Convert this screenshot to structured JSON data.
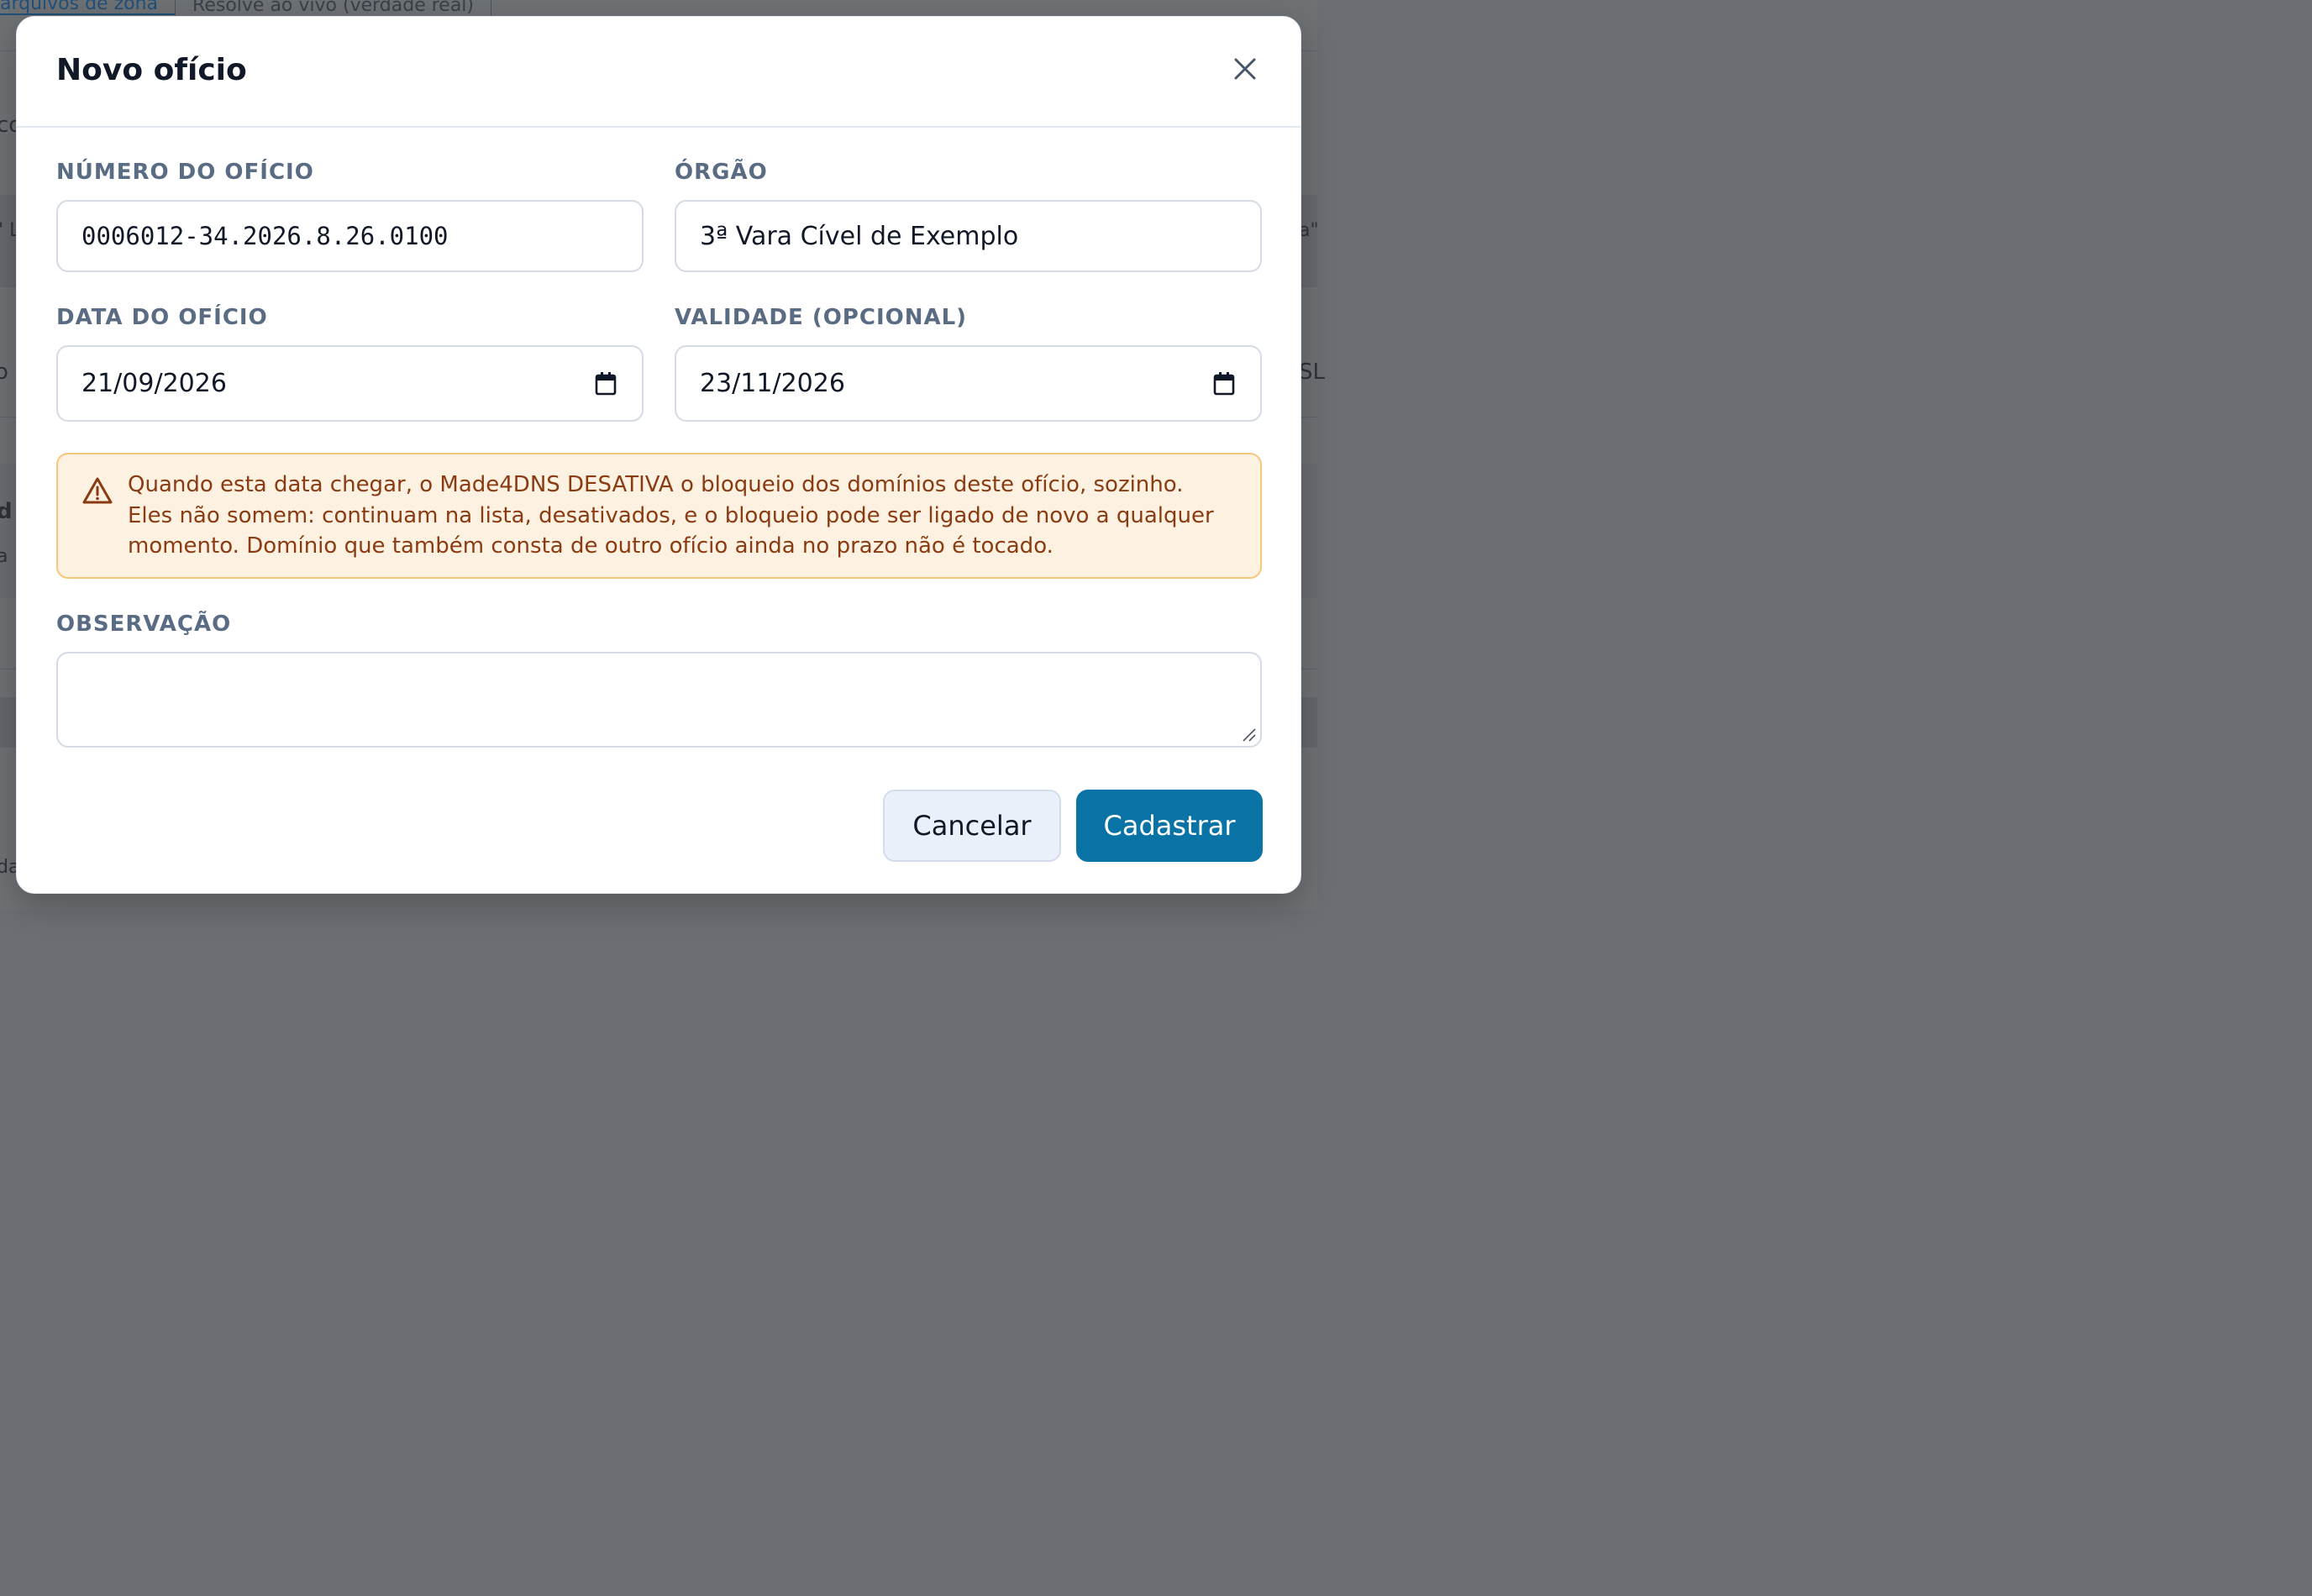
{
  "background": {
    "tabs": [
      {
        "label": "arquivos de zona",
        "active": true
      },
      {
        "label": "Resolve ao vivo (verdade real)",
        "active": false
      }
    ],
    "fragments": {
      "left1": "co",
      "left2": "\" L",
      "left3": "o",
      "left4": "d",
      "left5": "a",
      "left6": "da",
      "right1": "a\"",
      "right2": "SL"
    }
  },
  "modal": {
    "title": "Novo ofício",
    "close_icon": "close-icon",
    "fields": {
      "numero": {
        "label": "NÚMERO DO OFÍCIO",
        "value": "0006012-34.2026.8.26.0100"
      },
      "orgao": {
        "label": "ÓRGÃO",
        "value": "3ª Vara Cível de Exemplo"
      },
      "data": {
        "label": "DATA DO OFÍCIO",
        "value": "21/09/2026",
        "icon": "calendar-icon"
      },
      "validade": {
        "label": "VALIDADE (OPCIONAL)",
        "value": "23/11/2026",
        "icon": "calendar-icon"
      },
      "observacao": {
        "label": "OBSERVAÇÃO",
        "value": ""
      }
    },
    "warning": {
      "icon": "warning-triangle-icon",
      "text": "Quando esta data chegar, o Made4DNS DESATIVA o bloqueio dos domínios deste ofício, sozinho. Eles não somem: continuam na lista, desativados, e o bloqueio pode ser ligado de novo a qualquer momento. Domínio que também consta de outro ofício ainda no prazo não é tocado."
    },
    "buttons": {
      "cancel": "Cancelar",
      "submit": "Cadastrar"
    }
  },
  "colors": {
    "primary": "#0a73a6",
    "warning_bg": "#fdf1e1",
    "warning_border": "#f5c77a",
    "warning_text": "#8a3b12",
    "label": "#5a6b84"
  }
}
